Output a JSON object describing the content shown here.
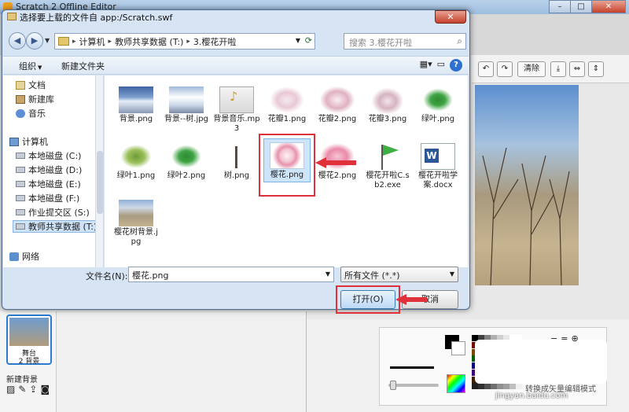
{
  "app": {
    "title": "Scratch 2 Offline Editor",
    "window_controls": [
      "–",
      "□",
      "✕"
    ]
  },
  "stage_toolbar": {
    "clear_label": "清除"
  },
  "sprites": {
    "stage_label": "舞台",
    "stage_count": "2 背景",
    "new_backdrop_label": "新建背景"
  },
  "paint": {
    "vector_mode_label": "转换成矢量编辑模式",
    "palette": [
      "#000000",
      "#404040",
      "#808080",
      "#b0b0b0",
      "#d0d0d0",
      "#e8e8e8",
      "#ffffff",
      "#ffffff",
      "#7a0000",
      "#b00000",
      "#ff0000",
      "#ff8080",
      "#ffc0c0",
      "#ffe0e0",
      "#ffd0a0",
      "#ffe8c0",
      "#7a4a00",
      "#c07000",
      "#ff9900",
      "#ffcc00",
      "#ffff00",
      "#ffff99",
      "#e0ff80",
      "#c0ff80",
      "#006000",
      "#00a000",
      "#00e000",
      "#80ff80",
      "#00a0a0",
      "#00e0e0",
      "#80ffff",
      "#c0ffff",
      "#000080",
      "#0000c0",
      "#0040ff",
      "#4080ff",
      "#80a0ff",
      "#c0c0ff",
      "#e0e0ff",
      "#f0f0ff",
      "#400080",
      "#8000c0",
      "#c000ff",
      "#e080ff",
      "#ff00c0",
      "#ff80e0",
      "#ffc0f0",
      "#fff0fa",
      "#402000",
      "#603000",
      "#804020",
      "#a06040",
      "#c08060",
      "#e0a080",
      "#f0c0a0",
      "#ffe0c0",
      "#202020",
      "#303030",
      "#505050",
      "#707070",
      "#909090",
      "#a0a0a0",
      "#c0c0c0",
      "#f0f0f0"
    ]
  },
  "dialog": {
    "title": "选择要上载的文件自 app:/Scratch.swf",
    "close_label": "✕",
    "address": {
      "crumbs": [
        "计算机",
        "教师共享数据 (T:)",
        "3.樱花开啦"
      ],
      "separator": "▸"
    },
    "search_placeholder": "搜索 3.樱花开啦",
    "commands": {
      "organize": "组织",
      "new_folder": "新建文件夹"
    },
    "nav": [
      {
        "label": "文档",
        "icon": "document-icon"
      },
      {
        "label": "新建库",
        "icon": "library-icon"
      },
      {
        "label": "音乐",
        "icon": "music-icon"
      },
      {
        "label": "计算机",
        "icon": "computer-icon"
      },
      {
        "label": "本地磁盘 (C:)",
        "icon": "drive-icon"
      },
      {
        "label": "本地磁盘 (D:)",
        "icon": "drive-icon"
      },
      {
        "label": "本地磁盘 (E:)",
        "icon": "drive-icon"
      },
      {
        "label": "本地磁盘 (F:)",
        "icon": "drive-icon"
      },
      {
        "label": "作业提交区 (S:)",
        "icon": "network-drive-icon"
      },
      {
        "label": "教师共享数据 (T:)",
        "icon": "network-drive-icon"
      },
      {
        "label": "网络",
        "icon": "network-icon"
      }
    ],
    "files": [
      {
        "name": "背景.png"
      },
      {
        "name": "背景--树.jpg"
      },
      {
        "name": "背景音乐.mp3"
      },
      {
        "name": "花瓣1.png"
      },
      {
        "name": "花瓣2.png"
      },
      {
        "name": "花瓣3.png"
      },
      {
        "name": "绿叶.png"
      },
      {
        "name": "绿叶1.png"
      },
      {
        "name": "绿叶2.png"
      },
      {
        "name": "树.png"
      },
      {
        "name": "樱花.png"
      },
      {
        "name": "樱花2.png"
      },
      {
        "name": "樱花开啦C.sb2.exe"
      },
      {
        "name": "樱花开啦学案.docx"
      },
      {
        "name": "樱花树背景.jpg"
      }
    ],
    "filename_label": "文件名(N):",
    "filename_value": "樱花.png",
    "filetype_value": "所有文件 (*.*)",
    "open_label": "打开(O)",
    "cancel_label": "取消"
  },
  "watermark": "jingyan.baidu.com",
  "colors": {
    "highlight": "#e0303a",
    "selection": "#cde5fb"
  }
}
